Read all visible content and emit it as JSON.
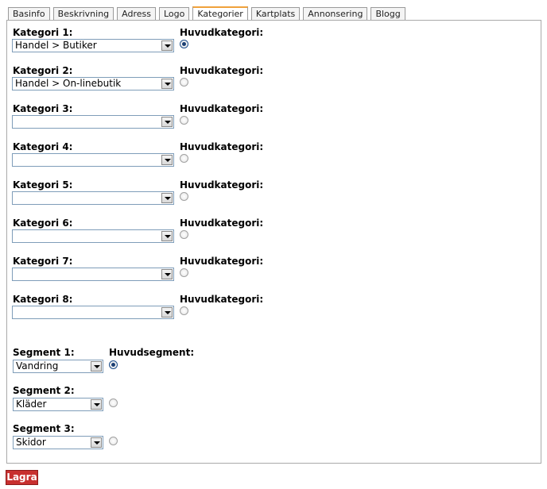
{
  "tabs": [
    {
      "label": "Basinfo",
      "active": false
    },
    {
      "label": "Beskrivning",
      "active": false
    },
    {
      "label": "Adress",
      "active": false
    },
    {
      "label": "Logo",
      "active": false
    },
    {
      "label": "Kategorier",
      "active": true
    },
    {
      "label": "Kartplats",
      "active": false
    },
    {
      "label": "Annonsering",
      "active": false
    },
    {
      "label": "Blogg",
      "active": false
    }
  ],
  "categories": [
    {
      "label": "Kategori 1:",
      "value": "Handel > Butiker",
      "main_label": "Huvudkategori:",
      "main": true
    },
    {
      "label": "Kategori 2:",
      "value": "Handel > On-linebutik",
      "main_label": "Huvudkategori:",
      "main": false
    },
    {
      "label": "Kategori 3:",
      "value": "",
      "main_label": "Huvudkategori:",
      "main": false
    },
    {
      "label": "Kategori 4:",
      "value": "",
      "main_label": "Huvudkategori:",
      "main": false
    },
    {
      "label": "Kategori 5:",
      "value": "",
      "main_label": "Huvudkategori:",
      "main": false
    },
    {
      "label": "Kategori 6:",
      "value": "",
      "main_label": "Huvudkategori:",
      "main": false
    },
    {
      "label": "Kategori 7:",
      "value": "",
      "main_label": "Huvudkategori:",
      "main": false
    },
    {
      "label": "Kategori 8:",
      "value": "",
      "main_label": "Huvudkategori:",
      "main": false
    }
  ],
  "segments": {
    "main_label": "Huvudsegment:",
    "items": [
      {
        "label": "Segment 1:",
        "value": "Vandring",
        "main": true
      },
      {
        "label": "Segment 2:",
        "value": "Kläder",
        "main": false
      },
      {
        "label": "Segment 3:",
        "value": "Skidor",
        "main": false
      }
    ]
  },
  "save_label": "Lagra",
  "colors": {
    "active_tab_accent": "#f0a23b",
    "save_button": "#c8302f",
    "radio_checked": "#1b3f73"
  }
}
